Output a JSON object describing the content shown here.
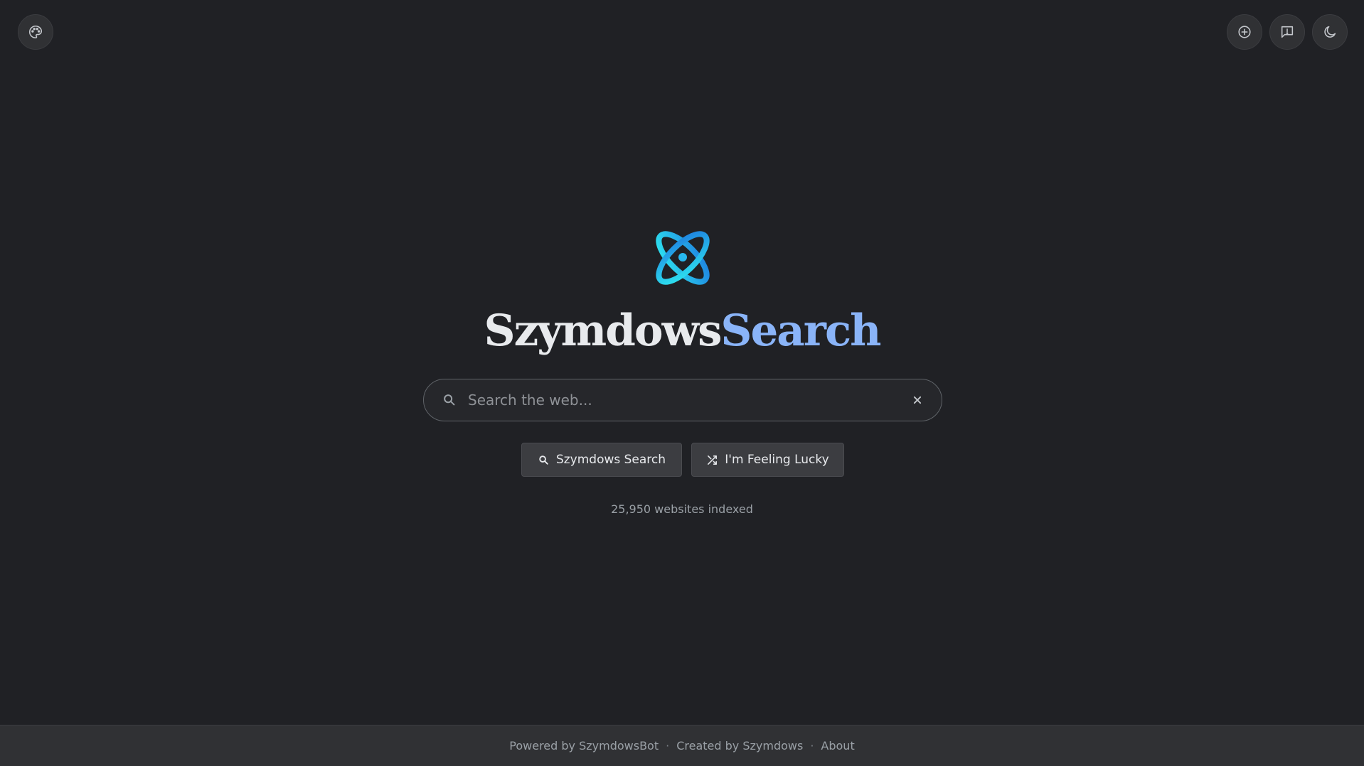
{
  "header": {
    "left_icon": "palette-icon",
    "right_icons": [
      "add-circle-icon",
      "feedback-icon",
      "moon-icon"
    ]
  },
  "brand": {
    "logo_icon": "orbit-logo-icon",
    "name_primary": "Szymdows",
    "name_accent": "Search",
    "accent_color": "#8ab4f8",
    "logo_gradient": [
      "#2ec9f5",
      "#1e88e5"
    ]
  },
  "search": {
    "placeholder": "Search the web...",
    "value": ""
  },
  "buttons": {
    "search_label": "Szymdows Search",
    "lucky_label": "I'm Feeling Lucky"
  },
  "stats": {
    "indexed_text": "25,950 websites indexed"
  },
  "footer": {
    "powered_by": "Powered by SzymdowsBot",
    "created_by": "Created by Szymdows",
    "about": "About",
    "separator": "·"
  }
}
